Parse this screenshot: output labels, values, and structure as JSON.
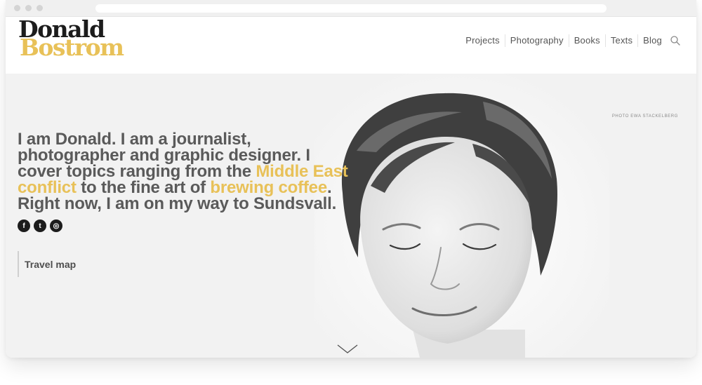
{
  "header": {
    "logo_line1": "Donald",
    "logo_line2": "Bostrom",
    "nav": [
      "Projects",
      "Photography",
      "Books",
      "Texts",
      "Blog"
    ],
    "search_icon": "search-icon"
  },
  "hero": {
    "photo_credit": "PHOTO EWA STACKELBERG",
    "intro_part1": "I am Donald. I am a journalist, photographer and graphic designer. I cover topics ranging from the ",
    "link1": "Middle East conflict",
    "intro_part2": " to the fine art of ",
    "link2": "brewing coffee",
    "intro_part3": ". Right now, I am on my way to Sundsvall.",
    "social": [
      "f",
      "t",
      "◎"
    ],
    "travel_map": "Travel map",
    "scroll_icon": "chevron-down-icon"
  },
  "colors": {
    "accent": "#e8c158",
    "text": "#5a5a5a",
    "logo_dark": "#1c1c1c"
  }
}
